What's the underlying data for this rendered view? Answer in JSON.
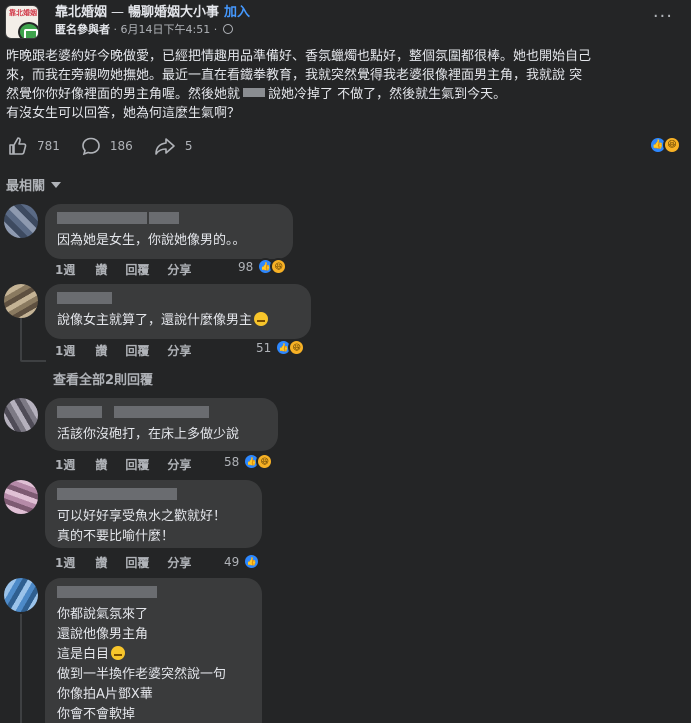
{
  "header": {
    "group_name": "靠北婚姻",
    "separator": "—",
    "subtitle": "暢聊婚姻大小事",
    "join_label": "加入",
    "author": "匿名參與者",
    "time": "6月14日下午4:51",
    "dot": "·",
    "avatar_text": "靠北婚姻",
    "more": "···"
  },
  "post": {
    "lines": [
      "昨晚跟老婆約好今晚做愛，已經把情趣用品準備好、香氛蠟燭也點好，整個氛圍都很棒。她也開始自己",
      "來，而我在旁親吻她撫她。最近一直在看鐵拳教育，我就突然覺得我老婆很像裡面男主角，我就說 突",
      "然覺你你好像裡面的男主角喔。然後她就",
      "說她冷掉了 不做了，然後就生氣到今天。",
      "有沒女生可以回答，她為何這麼生氣啊？"
    ],
    "likes": "781",
    "comments": "186",
    "shares": "5"
  },
  "sort_label": "最相關",
  "comments": [
    {
      "text": [
        "因為她是女生，你說她像男的。。"
      ],
      "time": "1週",
      "like": "讚",
      "reply": "回覆",
      "share": "分享",
      "count": "98"
    },
    {
      "text": [
        "說像女主就算了，還說什麼像男主"
      ],
      "time": "1週",
      "like": "讚",
      "reply": "回覆",
      "share": "分享",
      "count": "51"
    },
    {
      "text": [
        "活該你沒砲打，在床上多做少說"
      ],
      "time": "1週",
      "like": "讚",
      "reply": "回覆",
      "share": "分享",
      "count": "58"
    },
    {
      "text": [
        "可以好好享受魚水之歡就好！",
        "真的不要比喻什麼！"
      ],
      "time": "1週",
      "like": "讚",
      "reply": "回覆",
      "share": "分享",
      "count": "49"
    },
    {
      "text": [
        "你都說氣氛來了",
        "還說他像男主角",
        "這是白目",
        "做到一半換作老婆突然說一句",
        "你像拍A片鄧X華",
        "你會不會軟掉"
      ]
    }
  ],
  "view_replies": "查看全部2則回覆",
  "colors": {
    "background": "#242526",
    "bubble": "#3a3b3c",
    "accent": "#2d88ff",
    "muted": "#b0b3b8"
  }
}
